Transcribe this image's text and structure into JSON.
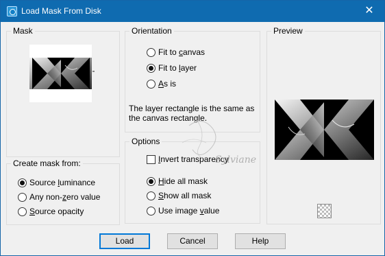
{
  "window": {
    "title": "Load Mask From Disk",
    "close_glyph": "✕"
  },
  "mask": {
    "label": "Mask"
  },
  "create_from": {
    "label": "Create mask from:",
    "options": [
      {
        "pre": "Source ",
        "key": "l",
        "post": "uminance",
        "selected": true
      },
      {
        "pre": "Any non-",
        "key": "z",
        "post": "ero value",
        "selected": false
      },
      {
        "pre": "",
        "key": "S",
        "post": "ource opacity",
        "selected": false
      }
    ]
  },
  "orientation": {
    "label": "Orientation",
    "options": [
      {
        "pre": "Fit to ",
        "key": "c",
        "post": "anvas",
        "selected": false
      },
      {
        "pre": "Fit to ",
        "key": "l",
        "post": "ayer",
        "selected": true
      },
      {
        "pre": "",
        "key": "A",
        "post": "s is",
        "selected": false
      }
    ],
    "info_line1": "The layer rectangle is the same as",
    "info_line2": "the canvas rectangle."
  },
  "options_group": {
    "label": "Options",
    "invert": {
      "pre": "",
      "key": "I",
      "post": "nvert transparency",
      "checked": false
    },
    "radios": [
      {
        "pre": "",
        "key": "H",
        "post": "ide all mask",
        "selected": true
      },
      {
        "pre": "",
        "key": "S",
        "post": "how all mask",
        "selected": false
      },
      {
        "pre": "Use image ",
        "key": "v",
        "post": "alue",
        "selected": false
      }
    ]
  },
  "preview": {
    "label": "Preview"
  },
  "watermark": {
    "text": "Sylviane"
  },
  "buttons": {
    "load": "Load",
    "cancel": "Cancel",
    "help": "Help"
  }
}
